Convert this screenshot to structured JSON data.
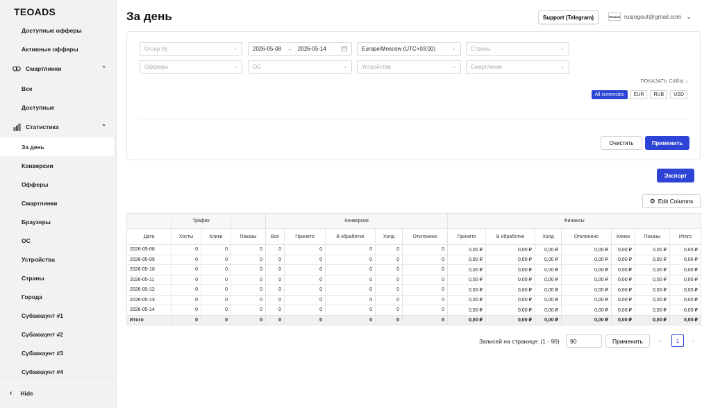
{
  "app": {
    "logo": "TEOADS"
  },
  "sidebar": {
    "top_items": [
      {
        "label": "Доступные офферы"
      },
      {
        "label": "Активные офферы"
      }
    ],
    "groups": [
      {
        "label": "Смартлинки",
        "icon": "link-icon",
        "items": [
          {
            "label": "Все"
          },
          {
            "label": "Доступные"
          }
        ]
      },
      {
        "label": "Статистика",
        "icon": "bar-chart-icon",
        "items": [
          {
            "label": "За день",
            "active": true
          },
          {
            "label": "Конверсии"
          },
          {
            "label": "Офферы"
          },
          {
            "label": "Смартлинки"
          },
          {
            "label": "Браузеры"
          },
          {
            "label": "ОС"
          },
          {
            "label": "Устройства"
          },
          {
            "label": "Страны"
          },
          {
            "label": "Города"
          },
          {
            "label": "Субаккаунт #1"
          },
          {
            "label": "Субаккаунт #2"
          },
          {
            "label": "Субаккаунт #3"
          },
          {
            "label": "Субаккаунт #4"
          }
        ]
      }
    ],
    "hide_label": "Hide"
  },
  "header": {
    "title": "За день",
    "support_label": "Support (Telegram)",
    "avatar_text": "TEOADS",
    "user_email": "rusjogout@gmail.com"
  },
  "filters": {
    "group_by": "Group By",
    "date_from": "2026-05-08",
    "date_to": "2026-05-14",
    "timezone": "Europe/Moscow (UTC+03:00)",
    "countries": "Страны",
    "offers": "Офферы",
    "os": "ОС",
    "devices": "Устройства",
    "smartlinks": "Смартлинки",
    "show_subs": "ПОКАЗАТЬ САБЫ",
    "currencies": [
      "All currencies",
      "EUR",
      "RUB",
      "USD"
    ],
    "active_currency": "All currencies",
    "clear_label": "Очистить",
    "apply_label": "Применить"
  },
  "actions": {
    "export_label": "Экспорт",
    "edit_columns_label": "Edit Columns"
  },
  "table": {
    "groups": [
      {
        "label": "",
        "span": 1
      },
      {
        "label": "Трафик",
        "span": 2
      },
      {
        "label": "",
        "span": 1
      },
      {
        "label": "Конверсии",
        "span": 5
      },
      {
        "label": "Финансы",
        "span": 8
      }
    ],
    "columns": [
      "Дата",
      "Хосты",
      "Клики",
      "Показы",
      "Все",
      "Принято",
      "В обработке",
      "Холд",
      "Отклонено",
      "Принято",
      "В обработке",
      "Холд",
      "Отклонено",
      "Клики",
      "Показы",
      "Итого"
    ],
    "rows": [
      [
        "2026-05-08",
        "0",
        "0",
        "0",
        "0",
        "0",
        "0",
        "0",
        "0",
        "0,00 ₽",
        "0,00 ₽",
        "0,00 ₽",
        "0,00 ₽",
        "0,00 ₽",
        "0,00 ₽",
        "0,00 ₽"
      ],
      [
        "2026-05-09",
        "0",
        "0",
        "0",
        "0",
        "0",
        "0",
        "0",
        "0",
        "0,00 ₽",
        "0,00 ₽",
        "0,00 ₽",
        "0,00 ₽",
        "0,00 ₽",
        "0,00 ₽",
        "0,00 ₽"
      ],
      [
        "2026-05-10",
        "0",
        "0",
        "0",
        "0",
        "0",
        "0",
        "0",
        "0",
        "0,00 ₽",
        "0,00 ₽",
        "0,00 ₽",
        "0,00 ₽",
        "0,00 ₽",
        "0,00 ₽",
        "0,00 ₽"
      ],
      [
        "2026-05-11",
        "0",
        "0",
        "0",
        "0",
        "0",
        "0",
        "0",
        "0",
        "0,00 ₽",
        "0,00 ₽",
        "0,00 ₽",
        "0,00 ₽",
        "0,00 ₽",
        "0,00 ₽",
        "0,00 ₽"
      ],
      [
        "2026-05-12",
        "0",
        "0",
        "0",
        "0",
        "0",
        "0",
        "0",
        "0",
        "0,00 ₽",
        "0,00 ₽",
        "0,00 ₽",
        "0,00 ₽",
        "0,00 ₽",
        "0,00 ₽",
        "0,00 ₽"
      ],
      [
        "2026-05-13",
        "0",
        "0",
        "0",
        "0",
        "0",
        "0",
        "0",
        "0",
        "0,00 ₽",
        "0,00 ₽",
        "0,00 ₽",
        "0,00 ₽",
        "0,00 ₽",
        "0,00 ₽",
        "0,00 ₽"
      ],
      [
        "2026-05-14",
        "0",
        "0",
        "0",
        "0",
        "0",
        "0",
        "0",
        "0",
        "0,00 ₽",
        "0,00 ₽",
        "0,00 ₽",
        "0,00 ₽",
        "0,00 ₽",
        "0,00 ₽",
        "0,00 ₽"
      ]
    ],
    "total": [
      "Итого",
      "0",
      "0",
      "0",
      "0",
      "0",
      "0",
      "0",
      "0",
      "0,00 ₽",
      "0,00 ₽",
      "0,00 ₽",
      "0,00 ₽",
      "0,00 ₽",
      "0,00 ₽",
      "0,00 ₽"
    ]
  },
  "pagination": {
    "label": "Записей на странице: (1 - 90)",
    "per_page": "90",
    "apply_label": "Применить",
    "current_page": "1"
  }
}
